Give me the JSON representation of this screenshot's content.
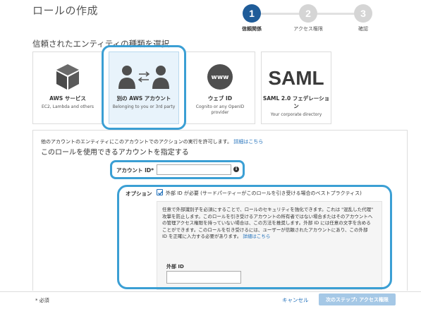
{
  "page": {
    "title": "ロールの作成",
    "subtitle": "信頼されたエンティティの種類を選択"
  },
  "steps": [
    {
      "number": "1",
      "label": "信頼関係",
      "state": "active"
    },
    {
      "number": "2",
      "label": "アクセス権限",
      "state": "inactive"
    },
    {
      "number": "3",
      "label": "確認",
      "state": "inactive"
    }
  ],
  "entity_cards": [
    {
      "title": "AWS サービス",
      "subtitle": "EC2, Lambda and others",
      "icon": "aws-service-cube-icon",
      "selected": false
    },
    {
      "title": "別の AWS アカウント",
      "subtitle": "Belonging to you or 3rd party",
      "icon": "two-users-icon",
      "selected": true
    },
    {
      "title": "ウェブ ID",
      "subtitle": "Cognito or any OpenID provider",
      "icon": "www-globe-icon",
      "icon_text": "www",
      "selected": false
    },
    {
      "title": "SAML 2.0 フェデレーション",
      "subtitle": "Your corporate directory",
      "icon": "saml-logo-icon",
      "icon_text": "SAML",
      "selected": false
    }
  ],
  "panel": {
    "info_text": "他のアカウントのエンティティにこのアカウントでのアクションの実行を許可します。",
    "info_link": "詳細はこちら",
    "heading": "このロールを使用できるアカウントを指定する",
    "account_id_label": "アカウント ID*",
    "account_id_value": "",
    "account_info_icon": "i",
    "options_label": "オプション",
    "external_id_checkbox_checked": true,
    "external_id_checkbox_text": "外部 ID が必要 (サードパーティーがこのロールを引き受ける場合のベストプラクティス)",
    "external_id_description": "任意で外部識別子を必須にすることで、ロールのセキュリティを強化できます。これは \"混乱した代理\" 攻撃を防止します。このロールを引き受けるアカウントの所有者ではない場合またはそのアカウントへの管理アクセス権限を持っていない場合は、この方法を推奨します。外部 ID には任意の文字を含めることができます。このロールを引き受けるには、ユーザーが信頼されたアカウントにあり、この外部 ID を正確に入力する必要があります。",
    "external_id_link": "詳細はこちら",
    "external_id_label": "外部 ID",
    "external_id_value": ""
  },
  "footer": {
    "required_note": "* 必須",
    "cancel_label": "キャンセル",
    "next_label": "次のステップ: アクセス権限"
  },
  "colors": {
    "step_active": "#1f5c99",
    "step_inactive": "#d5d5d5",
    "highlight_ring": "#3b9fd4",
    "link": "#1f6fba",
    "next_button_disabled": "#a5c8e6",
    "selected_card_bg": "#e8f3fb"
  }
}
